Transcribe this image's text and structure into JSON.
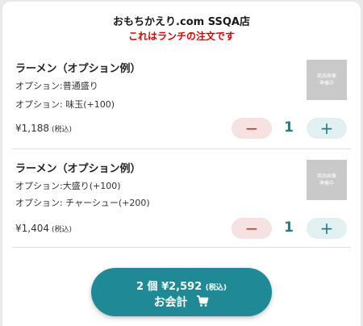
{
  "store": {
    "title": "おもちかえり.com SSQA店",
    "note": "これはランチの注文です"
  },
  "items": [
    {
      "name": "ラーメン（オプション例）",
      "options": [
        "オプション:普通盛り",
        "オプション: 味玉(+100)"
      ],
      "price": "¥1,188",
      "tax_label": "(税込)",
      "image_placeholder": [
        "商品画像",
        "準備中"
      ],
      "quantity": "1",
      "minus_symbol": "−",
      "plus_symbol": "+"
    },
    {
      "name": "ラーメン（オプション例）",
      "options": [
        "オプション:大盛り(+100)",
        "オプション: チャーシュー(+200)"
      ],
      "price": "¥1,404",
      "tax_label": "(税込)",
      "image_placeholder": [
        "商品画像",
        "準備中"
      ],
      "quantity": "1",
      "minus_symbol": "−",
      "plus_symbol": "+"
    }
  ],
  "checkout": {
    "summary": "2 個 ¥2,592",
    "tax_label": "(税込)",
    "label": "お会計",
    "icon": "cart-icon"
  },
  "colors": {
    "accent": "#1f8a96",
    "note_red": "#e00000",
    "minus_bg": "#f6e2e0",
    "plus_bg": "#e2f0f1"
  }
}
